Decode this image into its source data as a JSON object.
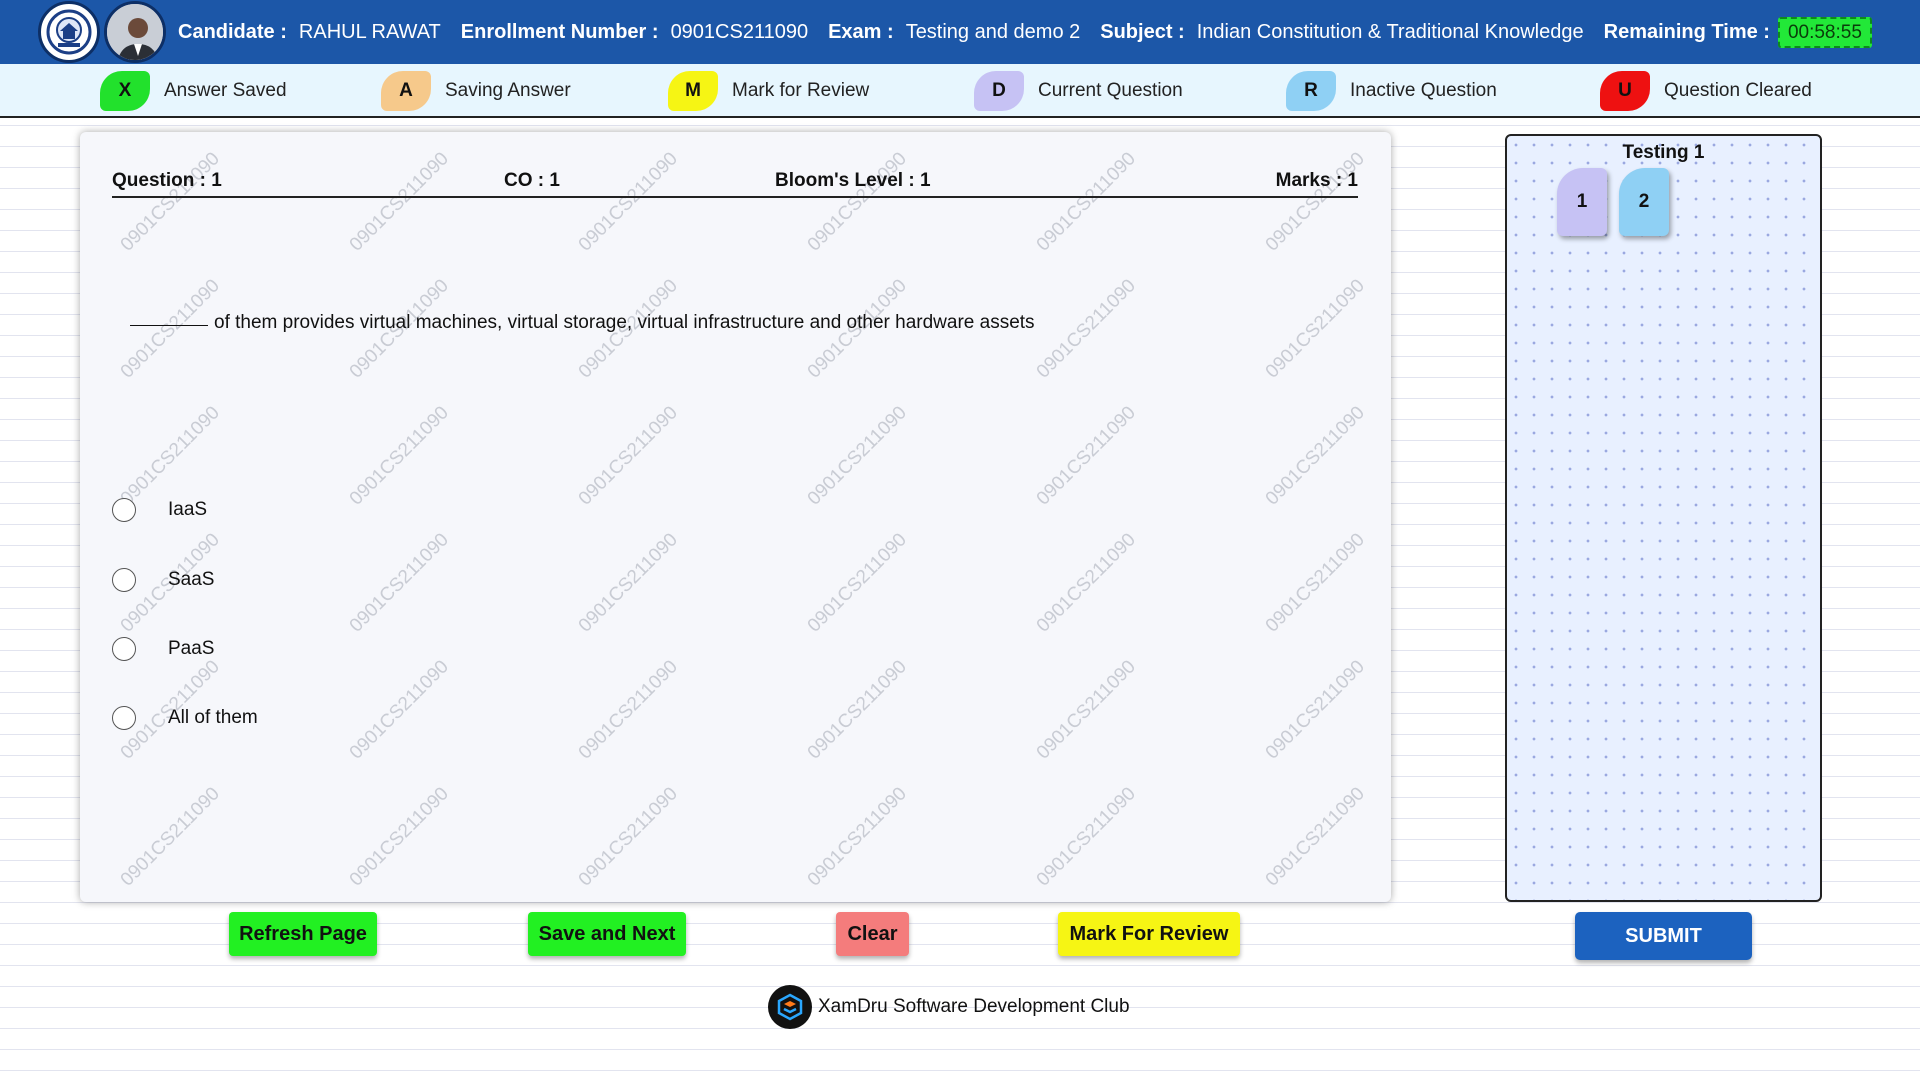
{
  "header": {
    "candidate_label": "Candidate :",
    "candidate_value": "RAHUL RAWAT",
    "enrollment_label": "Enrollment Number :",
    "enrollment_value": "0901CS211090",
    "exam_label": "Exam :",
    "exam_value": "Testing and demo 2",
    "subject_label": "Subject :",
    "subject_value": "Indian Constitution & Traditional Knowledge",
    "time_label": "Remaining Time :",
    "time_value": "00:58:55"
  },
  "legend": [
    {
      "code": "X",
      "label": "Answer Saved",
      "color": "#22e12c"
    },
    {
      "code": "A",
      "label": "Saving Answer",
      "color": "#f6c98b"
    },
    {
      "code": "M",
      "label": "Mark for Review",
      "color": "#f6f514"
    },
    {
      "code": "D",
      "label": "Current Question",
      "color": "#c6c2f4"
    },
    {
      "code": "R",
      "label": "Inactive Question",
      "color": "#8fd0f4"
    },
    {
      "code": "U",
      "label": "Question Cleared",
      "color": "#ee1111"
    }
  ],
  "question": {
    "number_label": "Question : 1",
    "co_label": "CO : 1",
    "bloom_label": "Bloom's Level : 1",
    "marks_label": "Marks : 1",
    "text": "of them provides virtual machines, virtual storage, virtual infrastructure and other hardware assets",
    "options": [
      "IaaS",
      "SaaS",
      "PaaS",
      "All of them"
    ],
    "watermark": "0901CS211090"
  },
  "navigator": {
    "title": "Testing 1",
    "questions": [
      {
        "label": "1",
        "color": "#c6c2f4"
      },
      {
        "label": "2",
        "color": "#8fd0f4"
      }
    ]
  },
  "actions": {
    "refresh": "Refresh Page",
    "save_next": "Save and Next",
    "clear": "Clear",
    "mark_review": "Mark For Review",
    "submit": "SUBMIT"
  },
  "footer": {
    "text": "XamDru Software Development Club"
  }
}
